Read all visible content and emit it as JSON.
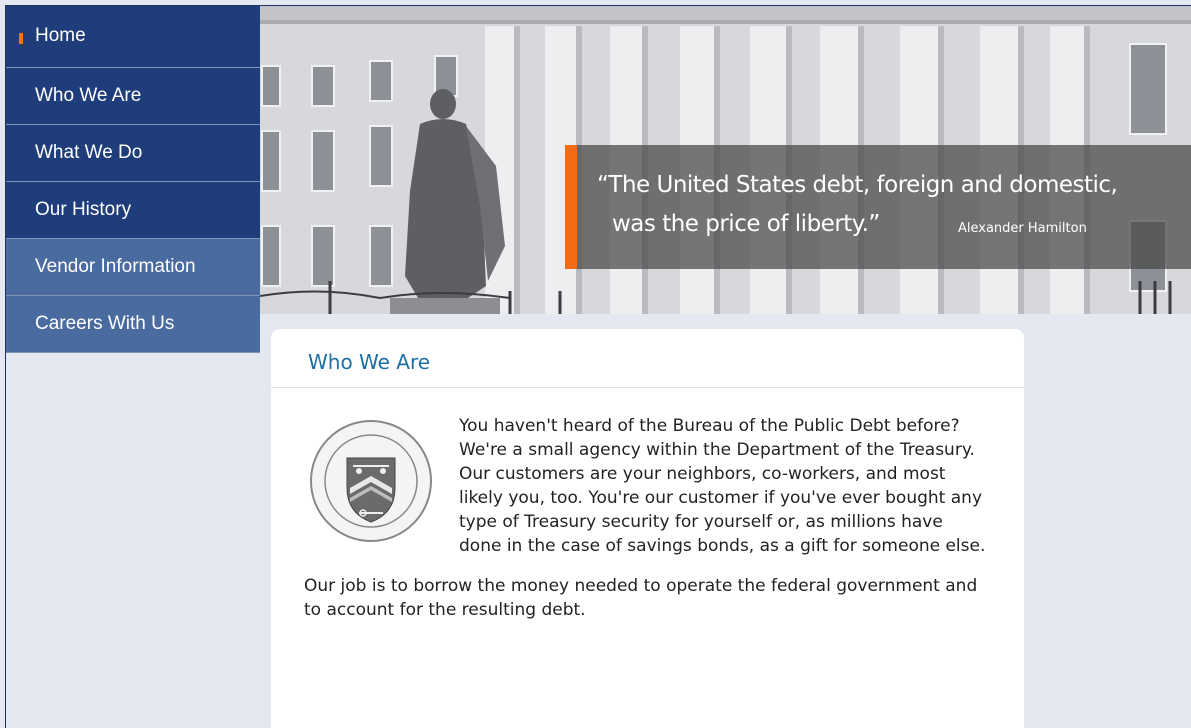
{
  "nav": {
    "items": [
      {
        "label": "Home",
        "active": true
      },
      {
        "label": "Who We Are"
      },
      {
        "label": "What We Do"
      },
      {
        "label": "Our History"
      },
      {
        "label": "Vendor Information"
      },
      {
        "label": "Careers With Us"
      }
    ]
  },
  "hero": {
    "quote_line1": "“The United States debt, foreign and domestic,",
    "quote_line2": "was the price of liberty.”",
    "quote_author": "Alexander Hamilton"
  },
  "content": {
    "title": "Who We Are",
    "seal_icon": "treasury-public-debt-seal",
    "paragraphs": [
      "You haven't heard of the Bureau of the Public Debt before? We're a small agency within the Department of the Treasury. Our customers are your neighbors, co-workers, and most likely you, too. You're our customer if you've ever bought any type of Treasury security for yourself or, as millions have done in the case of savings bonds, as a gift for someone else.",
      "Our job is to borrow the money needed to operate the federal government and to account for the resulting debt."
    ]
  },
  "colors": {
    "nav_dark": "#1f3d7a",
    "nav_light": "#4a6b9f",
    "accent_orange": "#f26b15",
    "title_blue": "#1d6fa3",
    "page_bg": "#e3e8f1"
  }
}
